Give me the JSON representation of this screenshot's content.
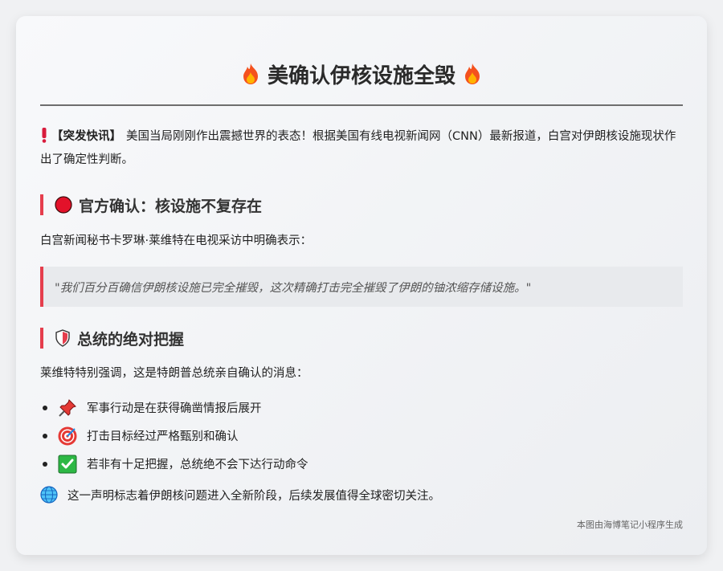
{
  "title": "美确认伊核设施全毁",
  "intro": {
    "tag": "【突发快讯】",
    "text": "美国当局刚刚作出震撼世界的表态！根据美国有线电视新闻网（CNN）最新报道，白宫对伊朗核设施现状作出了确定性判断。"
  },
  "section1": {
    "heading": "官方确认：核设施不复存在",
    "paragraph": "白宫新闻秘书卡罗琳·莱维特在电视采访中明确表示：",
    "quote": "\"我们百分百确信伊朗核设施已完全摧毁，这次精确打击完全摧毁了伊朗的铀浓缩存储设施。\""
  },
  "section2": {
    "heading": "总统的绝对把握",
    "paragraph": "莱维特特别强调，这是特朗普总统亲自确认的消息：",
    "bullets": [
      {
        "icon": "pushpin-icon",
        "text": "军事行动是在获得确凿情报后展开"
      },
      {
        "icon": "target-icon",
        "text": "打击目标经过严格甄别和确认"
      },
      {
        "icon": "check-mark-icon",
        "text": "若非有十足把握，总统绝不会下达行动命令"
      }
    ]
  },
  "closing": "这一声明标志着伊朗核问题进入全新阶段，后续发展值得全球密切关注。",
  "footer": "本图由海博笔记小程序生成",
  "colors": {
    "accent": "#e53e4d",
    "text": "#222222",
    "quote_bg": "#e8eaed"
  }
}
